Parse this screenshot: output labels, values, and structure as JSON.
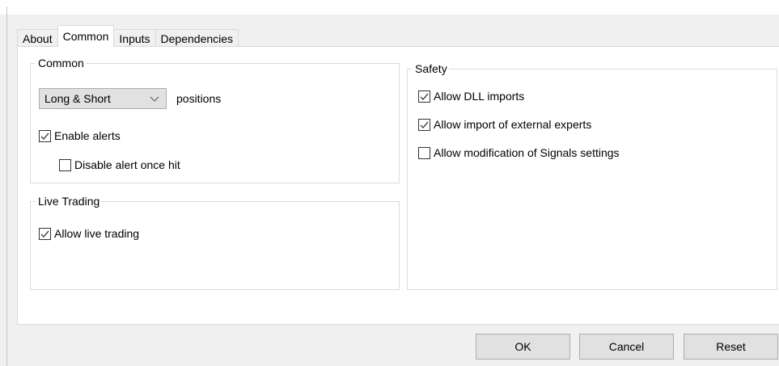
{
  "tabs": [
    {
      "label": "About"
    },
    {
      "label": "Common"
    },
    {
      "label": "Inputs"
    },
    {
      "label": "Dependencies"
    }
  ],
  "active_tab": "Common",
  "common_group": {
    "legend": "Common",
    "positions_select": {
      "value": "Long & Short"
    },
    "positions_label": "positions",
    "enable_alerts": {
      "label": "Enable alerts",
      "checked": true
    },
    "disable_alert_once_hit": {
      "label": "Disable alert once hit",
      "checked": false
    }
  },
  "live_trading_group": {
    "legend": "Live Trading",
    "allow_live_trading": {
      "label": "Allow live trading",
      "checked": true
    }
  },
  "safety_group": {
    "legend": "Safety",
    "allow_dll_imports": {
      "label": "Allow DLL imports",
      "checked": true
    },
    "allow_external_experts": {
      "label": "Allow import of external experts",
      "checked": true
    },
    "allow_signals_modification": {
      "label": "Allow modification of Signals settings",
      "checked": false
    }
  },
  "buttons": {
    "ok": "OK",
    "cancel": "Cancel",
    "reset": "Reset"
  },
  "colors": {
    "dialog_bg": "#f0f0f0",
    "page_bg": "#ffffff",
    "button_bg": "#e1e1e1",
    "border": "#adadad"
  }
}
